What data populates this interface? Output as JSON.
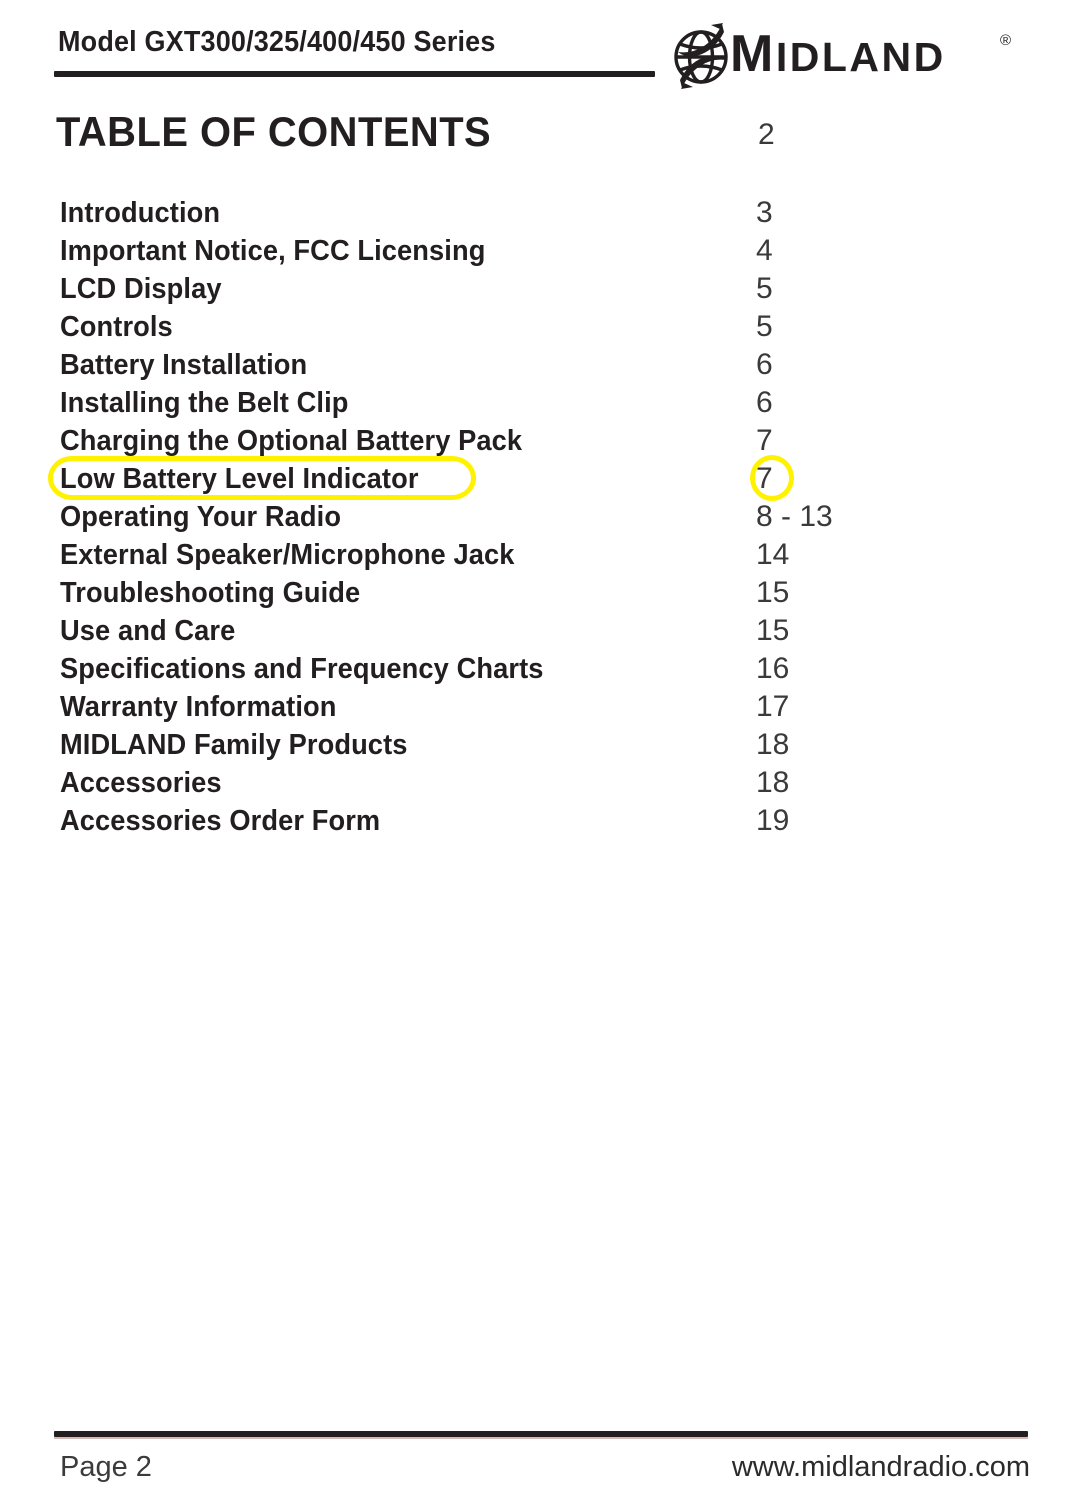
{
  "header": {
    "model_line": "Model GXT300/325/400/450 Series",
    "logo": {
      "icon": "globe-swoosh-icon",
      "wordmark_m": "M",
      "wordmark_rest": "IDLAND",
      "registered_mark": "®"
    }
  },
  "title": {
    "heading": "TABLE OF CONTENTS",
    "page": "2"
  },
  "toc": {
    "entries": [
      {
        "label": "Introduction",
        "page": "3",
        "highlighted": false
      },
      {
        "label": "Important Notice, FCC Licensing",
        "page": "4",
        "highlighted": false
      },
      {
        "label": "LCD Display",
        "page": "5",
        "highlighted": false
      },
      {
        "label": "Controls",
        "page": "5",
        "highlighted": false
      },
      {
        "label": "Battery Installation",
        "page": "6",
        "highlighted": false
      },
      {
        "label": "Installing the Belt Clip",
        "page": "6",
        "highlighted": false
      },
      {
        "label": "Charging the Optional Battery Pack",
        "page": "7",
        "highlighted": false
      },
      {
        "label": "Low Battery Level Indicator",
        "page": "7",
        "highlighted": true
      },
      {
        "label": "Operating Your Radio",
        "page": "8 - 13",
        "highlighted": false
      },
      {
        "label": "External Speaker/Microphone Jack",
        "page": "14",
        "highlighted": false
      },
      {
        "label": "Troubleshooting Guide",
        "page": "15",
        "highlighted": false
      },
      {
        "label": "Use and Care",
        "page": "15",
        "highlighted": false
      },
      {
        "label": "Specifications and Frequency Charts",
        "page": "16",
        "highlighted": false
      },
      {
        "label": "Warranty Information",
        "page": "17",
        "highlighted": false
      },
      {
        "label": "MIDLAND Family Products",
        "page": "18",
        "highlighted": false
      },
      {
        "label": "Accessories",
        "page": "18",
        "highlighted": false
      },
      {
        "label": "Accessories Order Form",
        "page": "19",
        "highlighted": false
      }
    ]
  },
  "annotation": {
    "color": "#fff200",
    "shape": "ellipse-outline",
    "target_label": "Low Battery Level Indicator",
    "target_page": "7"
  },
  "footer": {
    "page_label": "Page 2",
    "website": "www.midlandradio.com"
  },
  "colors": {
    "ink": "#231f20",
    "page_number": "#3a3a3a",
    "highlight": "#fff200",
    "paper": "#ffffff"
  }
}
